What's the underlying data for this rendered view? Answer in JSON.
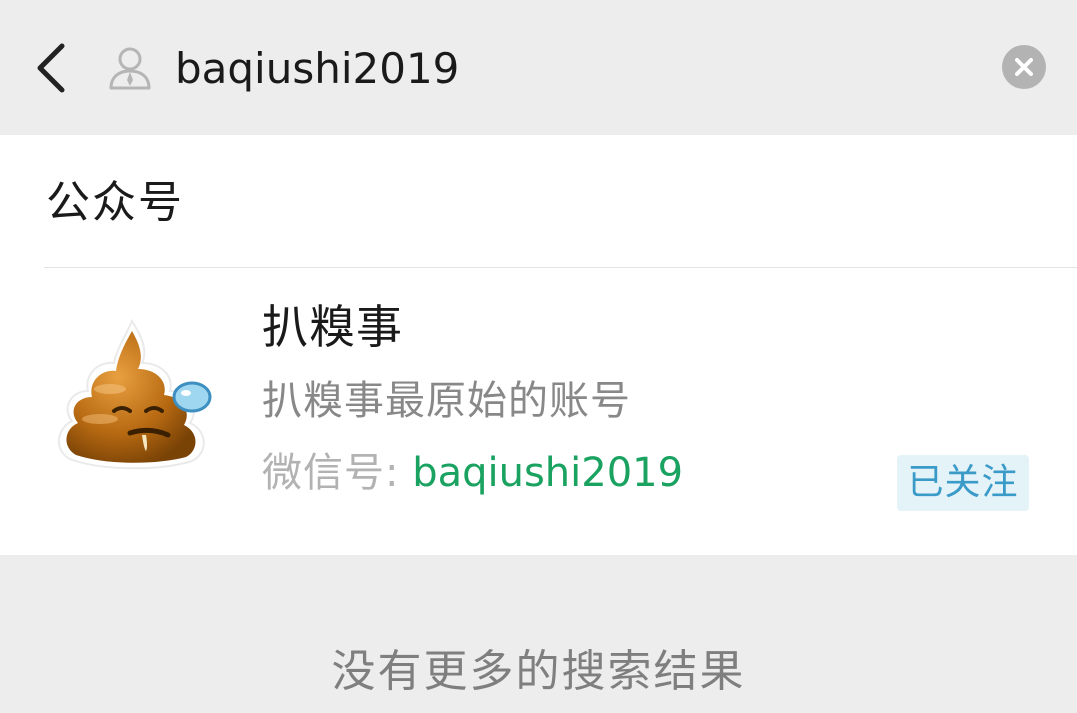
{
  "search": {
    "query": "baqiushi2019",
    "contact_icon": "contact-icon",
    "back_icon": "chevron-left-icon",
    "clear_icon": "close-icon"
  },
  "section": {
    "title": "公众号"
  },
  "result": {
    "name": "扒糗事",
    "description": "扒糗事最原始的账号",
    "wechat_id_label": "微信号:",
    "wechat_id": "baqiushi2019",
    "follow_status": "已关注",
    "avatar_icon": "poop-emoji-icon"
  },
  "footer": {
    "no_more_text": "没有更多的搜索结果"
  },
  "colors": {
    "background": "#ededed",
    "card": "#ffffff",
    "wechat_id": "#1aa260",
    "follow_badge_bg": "#e4f3f8",
    "follow_badge_text": "#3a9bc9"
  }
}
